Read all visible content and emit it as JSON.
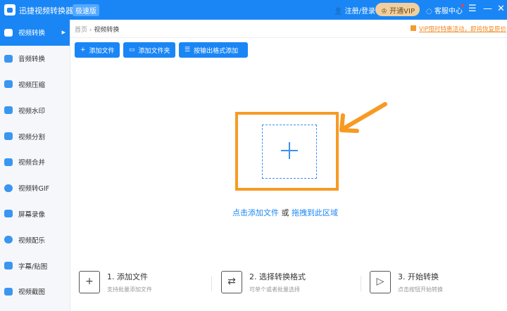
{
  "app": {
    "title": "迅捷视频转换器",
    "edition": "极速版",
    "login": "注册/登录",
    "vip": "开通VIP",
    "service": "客服中心",
    "menu": "☰",
    "minimize": "—",
    "close": "✕"
  },
  "sidebar": {
    "items": [
      {
        "label": "视频转换",
        "active": true
      },
      {
        "label": "音频转换"
      },
      {
        "label": "视频压缩"
      },
      {
        "label": "视频水印"
      },
      {
        "label": "视频分割"
      },
      {
        "label": "视频合并"
      },
      {
        "label": "视频转GIF"
      },
      {
        "label": "屏幕录像"
      },
      {
        "label": "视频配乐"
      },
      {
        "label": "字幕/贴图"
      },
      {
        "label": "视频截图"
      }
    ]
  },
  "breadcrumb": {
    "home": "首页",
    "sep": "›",
    "current": "视频转换"
  },
  "promo": "VIP限时特惠活动，即将恢复原价",
  "toolbar": {
    "add_file": "添加文件",
    "add_folder": "添加文件夹",
    "add_by_format": "按输出格式添加"
  },
  "dropzone": {
    "click_add": "点击添加文件",
    "or": "或",
    "drag": "拖拽到此区域"
  },
  "steps": [
    {
      "title": "1. 添加文件",
      "desc": "支持批量添加文件"
    },
    {
      "title": "2. 选择转换格式",
      "desc": "可单个或者批量选择"
    },
    {
      "title": "3. 开始转换",
      "desc": "点击按钮开始转换"
    }
  ],
  "colors": {
    "primary": "#1a86f5",
    "highlight": "#f79a23"
  }
}
